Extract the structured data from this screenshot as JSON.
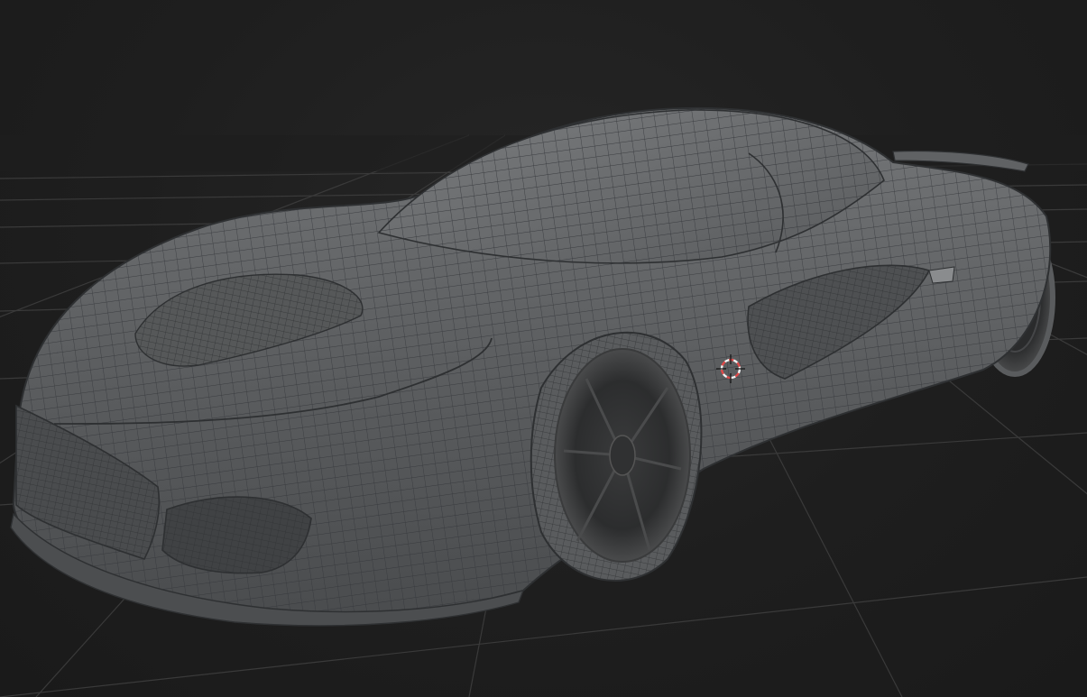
{
  "viewport": {
    "background_color": "#1d1d1d",
    "grid_color": "#3a3a3a",
    "model": {
      "shading": "solid-wireframe",
      "surface_color": "#5f6163",
      "wire_color": "#2e3032"
    },
    "cursor": {
      "icon": "3d-cursor-icon",
      "ring_color": "#e04a4a",
      "ring_color_alt": "#f2f2f2"
    }
  }
}
